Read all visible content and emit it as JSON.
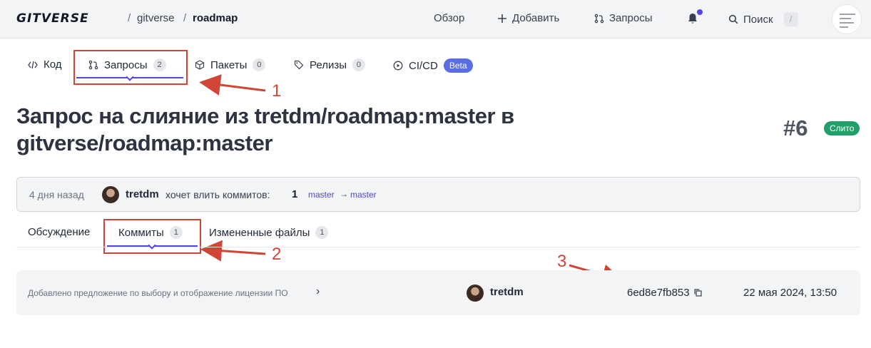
{
  "header": {
    "logo": "GITVERSE",
    "breadcrumb": [
      "gitverse",
      "roadmap"
    ],
    "separator": "/",
    "nav": {
      "overview": "Обзор",
      "add": "Добавить",
      "requests": "Запросы",
      "search": "Поиск",
      "search_shortcut": "/"
    },
    "icons": [
      "plus-icon",
      "pull-request-icon",
      "bell-icon",
      "search-icon"
    ]
  },
  "repo_tabs": [
    {
      "label": "Код",
      "icon": "code-icon"
    },
    {
      "label": "Запросы",
      "icon": "pull-request-icon",
      "count": "2",
      "active": true
    },
    {
      "label": "Пакеты",
      "icon": "package-icon",
      "count": "0"
    },
    {
      "label": "Релизы",
      "icon": "tag-icon",
      "count": "0"
    },
    {
      "label": "CI/CD",
      "icon": "play-circle-icon",
      "badge": "Beta"
    }
  ],
  "pr": {
    "title": "Запрос на слияние из tretdm/roadmap:master в gitverse/roadmap:master",
    "number": "#6",
    "status": "Слито",
    "status_color": "#22a06b",
    "time_ago": "4 дня назад",
    "author": "tretdm",
    "wants_text": "хочет влить коммитов:",
    "commit_count": "1",
    "source_branch": "master",
    "arrow": "→",
    "target_branch": "master"
  },
  "pr_tabs": [
    {
      "label": "Обсуждение"
    },
    {
      "label": "Коммиты",
      "count": "1",
      "active": true
    },
    {
      "label": "Измененные файлы",
      "count": "1"
    }
  ],
  "commits": [
    {
      "message": "Добавлено предложение по выбору и отображение лицензии ПО",
      "author": "tretdm",
      "sha": "6ed8e7fb853",
      "date": "22 мая 2024, 13:50"
    }
  ],
  "annotations": [
    "1",
    "2",
    "3"
  ],
  "colors": {
    "accent": "#4f46e5",
    "annotation": "#d14536",
    "beta": "#5b6ee1"
  }
}
